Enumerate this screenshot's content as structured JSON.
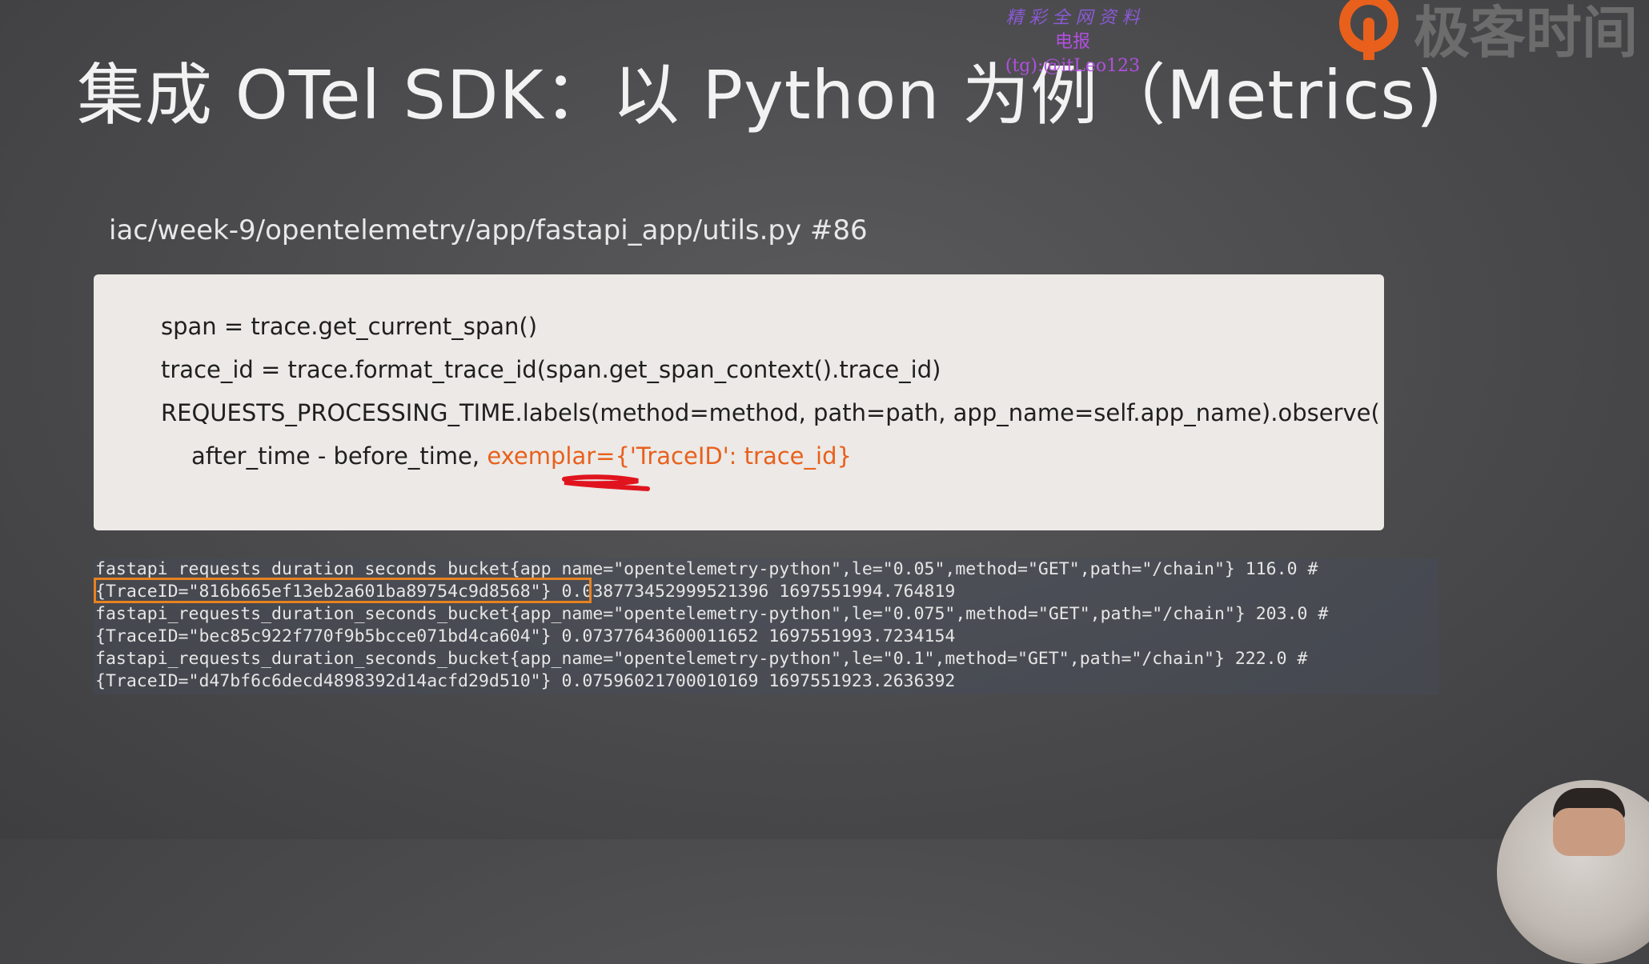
{
  "slide": {
    "title": "集成 OTel SDK：以 Python 为例（Metrics)"
  },
  "watermark": {
    "line1": "精 彩 全 网 资 料",
    "line2": "电报(tg):@itLeo123"
  },
  "brand": {
    "name": "极客时间",
    "accent_color": "#e8601c"
  },
  "file_path": "iac/week-9/opentelemetry/app/fastapi_app/utils.py   #86",
  "code": {
    "line1": "span = trace.get_current_span()",
    "line2": "trace_id = trace.format_trace_id(span.get_span_context().trace_id)",
    "line3": "REQUESTS_PROCESSING_TIME.labels(method=method, path=path, app_name=self.app_name).observe(",
    "line4_plain": "after_time - before_time, ",
    "line4_highlight": "exemplar={'TraceID': trace_id}",
    "highlight_color": "#e8601c"
  },
  "metrics_output": [
    "fastapi_requests_duration_seconds_bucket{app_name=\"opentelemetry-python\",le=\"0.05\",method=\"GET\",path=\"/chain\"} 116.0 #",
    "{TraceID=\"816b665ef13eb2a601ba89754c9d8568\"} 0.038773452999521396 1697551994.764819",
    "fastapi_requests_duration_seconds_bucket{app_name=\"opentelemetry-python\",le=\"0.075\",method=\"GET\",path=\"/chain\"} 203.0 #",
    "{TraceID=\"bec85c922f770f9b5bcce071bd4ca604\"} 0.07377643600011652 1697551993.7234154",
    "fastapi_requests_duration_seconds_bucket{app_name=\"opentelemetry-python\",le=\"0.1\",method=\"GET\",path=\"/chain\"} 222.0 #",
    "{TraceID=\"d47bf6c6decd4898392d14acfd29d510\"} 0.07596021700010169 1697551923.2636392"
  ],
  "highlight_box_color": "#e88220",
  "annotation_color": "#e0141e"
}
